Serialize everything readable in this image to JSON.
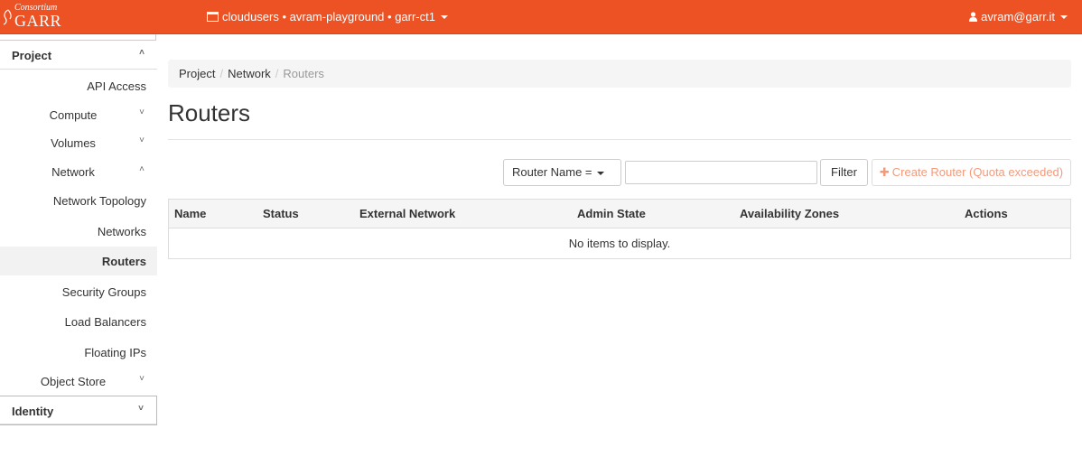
{
  "colors": {
    "brand": "#ec5224",
    "create_disabled_text": "#f39a7b"
  },
  "header": {
    "logo": {
      "line1": "Consortium",
      "line2": "GARR"
    },
    "project_switcher": {
      "icon": "window-icon",
      "label": "cloudusers • avram-playground • garr-ct1"
    },
    "user_menu": {
      "icon": "user-icon",
      "label": "avram@garr.it"
    }
  },
  "sidebar": {
    "project": {
      "label": "Project",
      "expanded": true
    },
    "items": [
      {
        "label": "API Access"
      },
      {
        "label": "Compute",
        "collapsible": true,
        "expanded": false
      },
      {
        "label": "Volumes",
        "collapsible": true,
        "expanded": false
      },
      {
        "label": "Network",
        "collapsible": true,
        "expanded": true
      },
      {
        "label": "Network Topology"
      },
      {
        "label": "Networks"
      },
      {
        "label": "Routers",
        "active": true
      },
      {
        "label": "Security Groups"
      },
      {
        "label": "Load Balancers"
      },
      {
        "label": "Floating IPs"
      },
      {
        "label": "Object Store",
        "collapsible": true,
        "expanded": false
      }
    ],
    "identity": {
      "label": "Identity",
      "expanded": false
    }
  },
  "breadcrumb": [
    "Project",
    "Network",
    "Routers"
  ],
  "page": {
    "title": "Routers"
  },
  "filter": {
    "field_label": "Router Name =",
    "input_value": "",
    "button_label": "Filter"
  },
  "create_button": {
    "label": "Create Router (Quota exceeded)",
    "icon": "plus-icon"
  },
  "table": {
    "columns": [
      "Name",
      "Status",
      "External Network",
      "Admin State",
      "Availability Zones",
      "Actions"
    ],
    "rows": [],
    "empty_message": "No items to display."
  }
}
